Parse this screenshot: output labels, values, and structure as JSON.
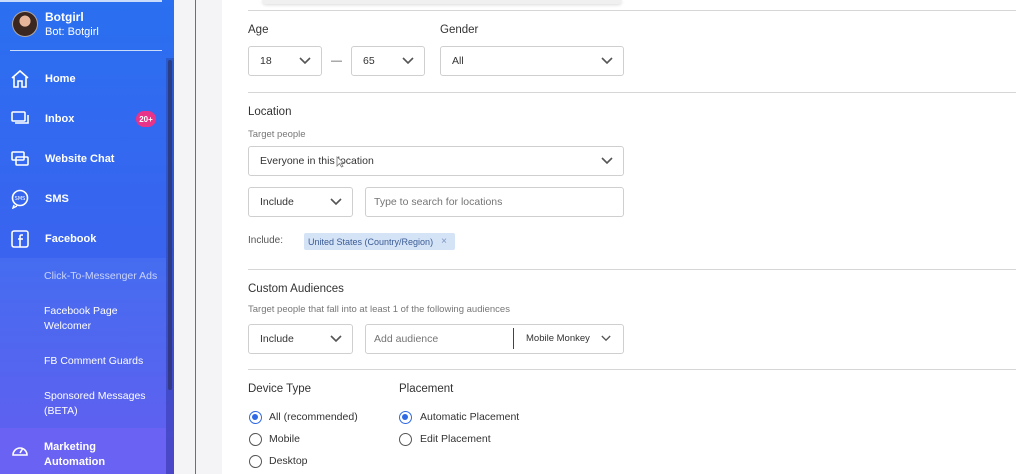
{
  "sidebar": {
    "user": {
      "name": "Botgirl",
      "bot": "Bot: Botgirl"
    },
    "nav": [
      {
        "label": "Home",
        "icon": "home-icon"
      },
      {
        "label": "Inbox",
        "icon": "inbox-icon",
        "badge": "20+"
      },
      {
        "label": "Website Chat",
        "icon": "chat-icon"
      },
      {
        "label": "SMS",
        "icon": "sms-icon"
      },
      {
        "label": "Facebook",
        "icon": "facebook-icon"
      }
    ],
    "facebook_submenu": [
      "Click-To-Messenger Ads",
      "Facebook Page Welcomer",
      "FB Comment Guards",
      "Sponsored Messages (BETA)"
    ],
    "marketing": {
      "label": "Marketing Automation",
      "icon": "gauge-icon"
    }
  },
  "age": {
    "title": "Age",
    "min": "18",
    "separator": "—",
    "max": "65"
  },
  "gender": {
    "title": "Gender",
    "value": "All"
  },
  "location": {
    "title": "Location",
    "subtitle": "Target people",
    "target_value": "Everyone in this location",
    "mode": "Include",
    "search_placeholder": "Type to search for locations",
    "include_label": "Include:",
    "tags": [
      {
        "label": "United States (Country/Region)",
        "remove": "×"
      }
    ]
  },
  "custom_audiences": {
    "title": "Custom Audiences",
    "subtitle": "Target people that fall into at least 1 of the following audiences",
    "mode": "Include",
    "audience_placeholder": "Add audience",
    "source": "Mobile Monkey"
  },
  "device_type": {
    "title": "Device Type",
    "options": [
      {
        "label": "All (recommended)",
        "checked": true
      },
      {
        "label": "Mobile",
        "checked": false
      },
      {
        "label": "Desktop",
        "checked": false
      }
    ]
  },
  "placement": {
    "title": "Placement",
    "options": [
      {
        "label": "Automatic Placement",
        "checked": true
      },
      {
        "label": "Edit Placement",
        "checked": false
      }
    ]
  },
  "colors": {
    "sidebar_top": "#2a6ff0",
    "sidebar_bottom": "#5a55ee",
    "accent": "#2f6ae5",
    "badge": "#e8338a",
    "tag_bg": "#d5e3f7"
  }
}
